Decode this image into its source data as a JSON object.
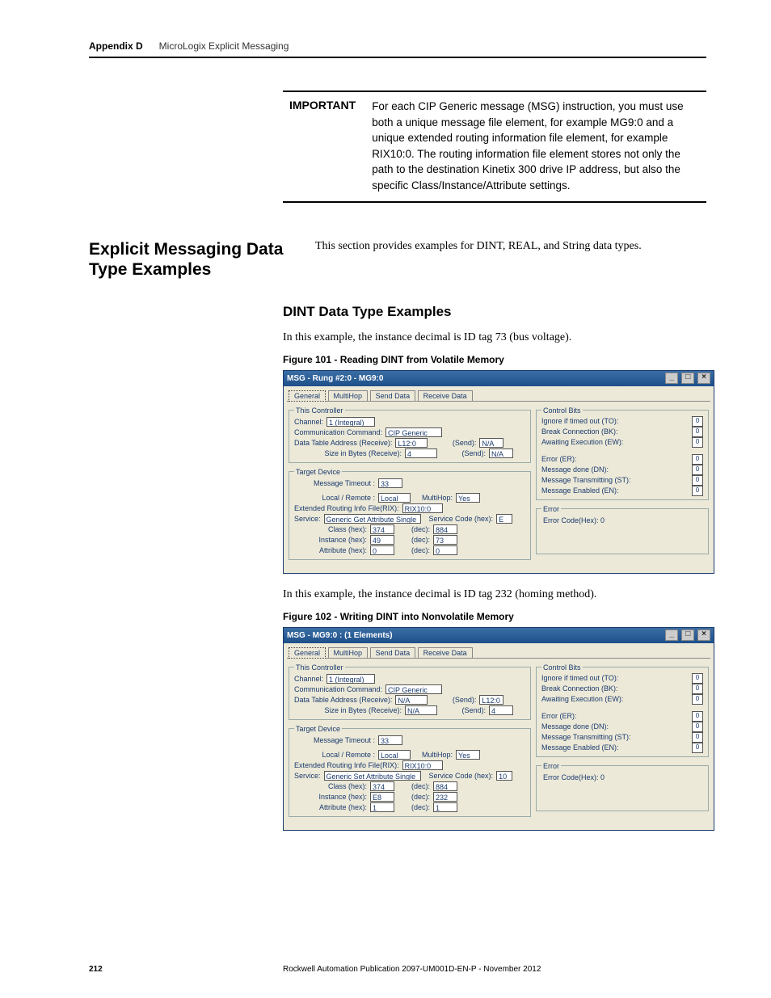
{
  "header": {
    "appendix": "Appendix D",
    "title": "MicroLogix Explicit Messaging"
  },
  "important": {
    "label": "IMPORTANT",
    "text": "For each CIP Generic message (MSG) instruction, you must use both a unique message file element, for example MG9:0 and a unique extended routing information file element, for example RIX10:0. The routing information file element stores not only the path to the destination Kinetix 300 drive IP address, but also the specific Class/Instance/Attribute settings."
  },
  "sectionHeading": "Explicit Messaging Data Type Examples",
  "sectionIntro": "This section provides examples for DINT, REAL, and String data types.",
  "subHeading": "DINT Data Type Examples",
  "example1Intro": "In this example, the instance decimal is ID tag 73 (bus voltage).",
  "fig101": "Figure 101 - Reading DINT from Volatile Memory",
  "example2Intro": "In this example, the instance decimal is ID tag 232 (homing method).",
  "fig102": "Figure 102 - Writing DINT into Nonvolatile Memory",
  "tabs": [
    "General",
    "MultiHop",
    "Send Data",
    "Receive Data"
  ],
  "controlBits": [
    {
      "label": "Ignore if timed out (TO):",
      "val": "0"
    },
    {
      "label": "Break Connection (BK):",
      "val": "0"
    },
    {
      "label": "Awaiting Execution (EW):",
      "val": "0"
    },
    {
      "label": "",
      "val": ""
    },
    {
      "label": "Error (ER):",
      "val": "0"
    },
    {
      "label": "Message done (DN):",
      "val": "0"
    },
    {
      "label": "Message Transmitting (ST):",
      "val": "0"
    },
    {
      "label": "Message Enabled (EN):",
      "val": "0"
    }
  ],
  "dialog1": {
    "title": "MSG - Rung #2:0 - MG9:0",
    "thisController": {
      "channel": "1 (Integral)",
      "commCmd": "CIP Generic",
      "dtaRecv": "L12:0",
      "dtaSend": "N/A",
      "sizeRecv": "4",
      "sizeSend": "N/A"
    },
    "target": {
      "timeout": "33",
      "localRemote": "Local",
      "multiHop": "Yes",
      "rix": "RIX10:0",
      "service": "Generic Get Attribute Single",
      "serviceCodeHex": "E",
      "classHex": "374",
      "classDec": "884",
      "instHex": "49",
      "instDec": "73",
      "attrHex": "0",
      "attrDec": "0"
    },
    "error": "Error Code(Hex):  0"
  },
  "dialog2": {
    "title": "MSG - MG9:0 : (1 Elements)",
    "thisController": {
      "channel": "1 (Integral)",
      "commCmd": "CIP Generic",
      "dtaRecv": "N/A",
      "dtaSend": "L12:0",
      "sizeRecv": "N/A",
      "sizeSend": "4"
    },
    "target": {
      "timeout": "33",
      "localRemote": "Local",
      "multiHop": "Yes",
      "rix": "RIX10:0",
      "service": "Generic Set Attribute Single",
      "serviceCodeHex": "10",
      "classHex": "374",
      "classDec": "884",
      "instHex": "E8",
      "instDec": "232",
      "attrHex": "1",
      "attrDec": "1"
    },
    "error": "Error Code(Hex):  0"
  },
  "fieldLabels": {
    "channel": "Channel:",
    "commCmd": "Communication Command:",
    "dtaRecv": "Data Table Address (Receive):",
    "sizeRecv": "Size in Bytes (Receive):",
    "sendParen": "(Send):",
    "timeout": "Message Timeout :",
    "localRemote": "Local / Remote :",
    "multiHop": "MultiHop:",
    "rix": "Extended Routing Info File(RIX):",
    "service": "Service:",
    "serviceCode": "Service Code (hex):",
    "classHex": "Class (hex):",
    "instHex": "Instance (hex):",
    "attrHex": "Attribute (hex):",
    "dec": "(dec):",
    "thisController": "This Controller",
    "targetDevice": "Target Device",
    "controlBits": "Control Bits",
    "errorLegend": "Error"
  },
  "footer": {
    "page": "212",
    "pub": "Rockwell Automation Publication 2097-UM001D-EN-P - November 2012"
  }
}
